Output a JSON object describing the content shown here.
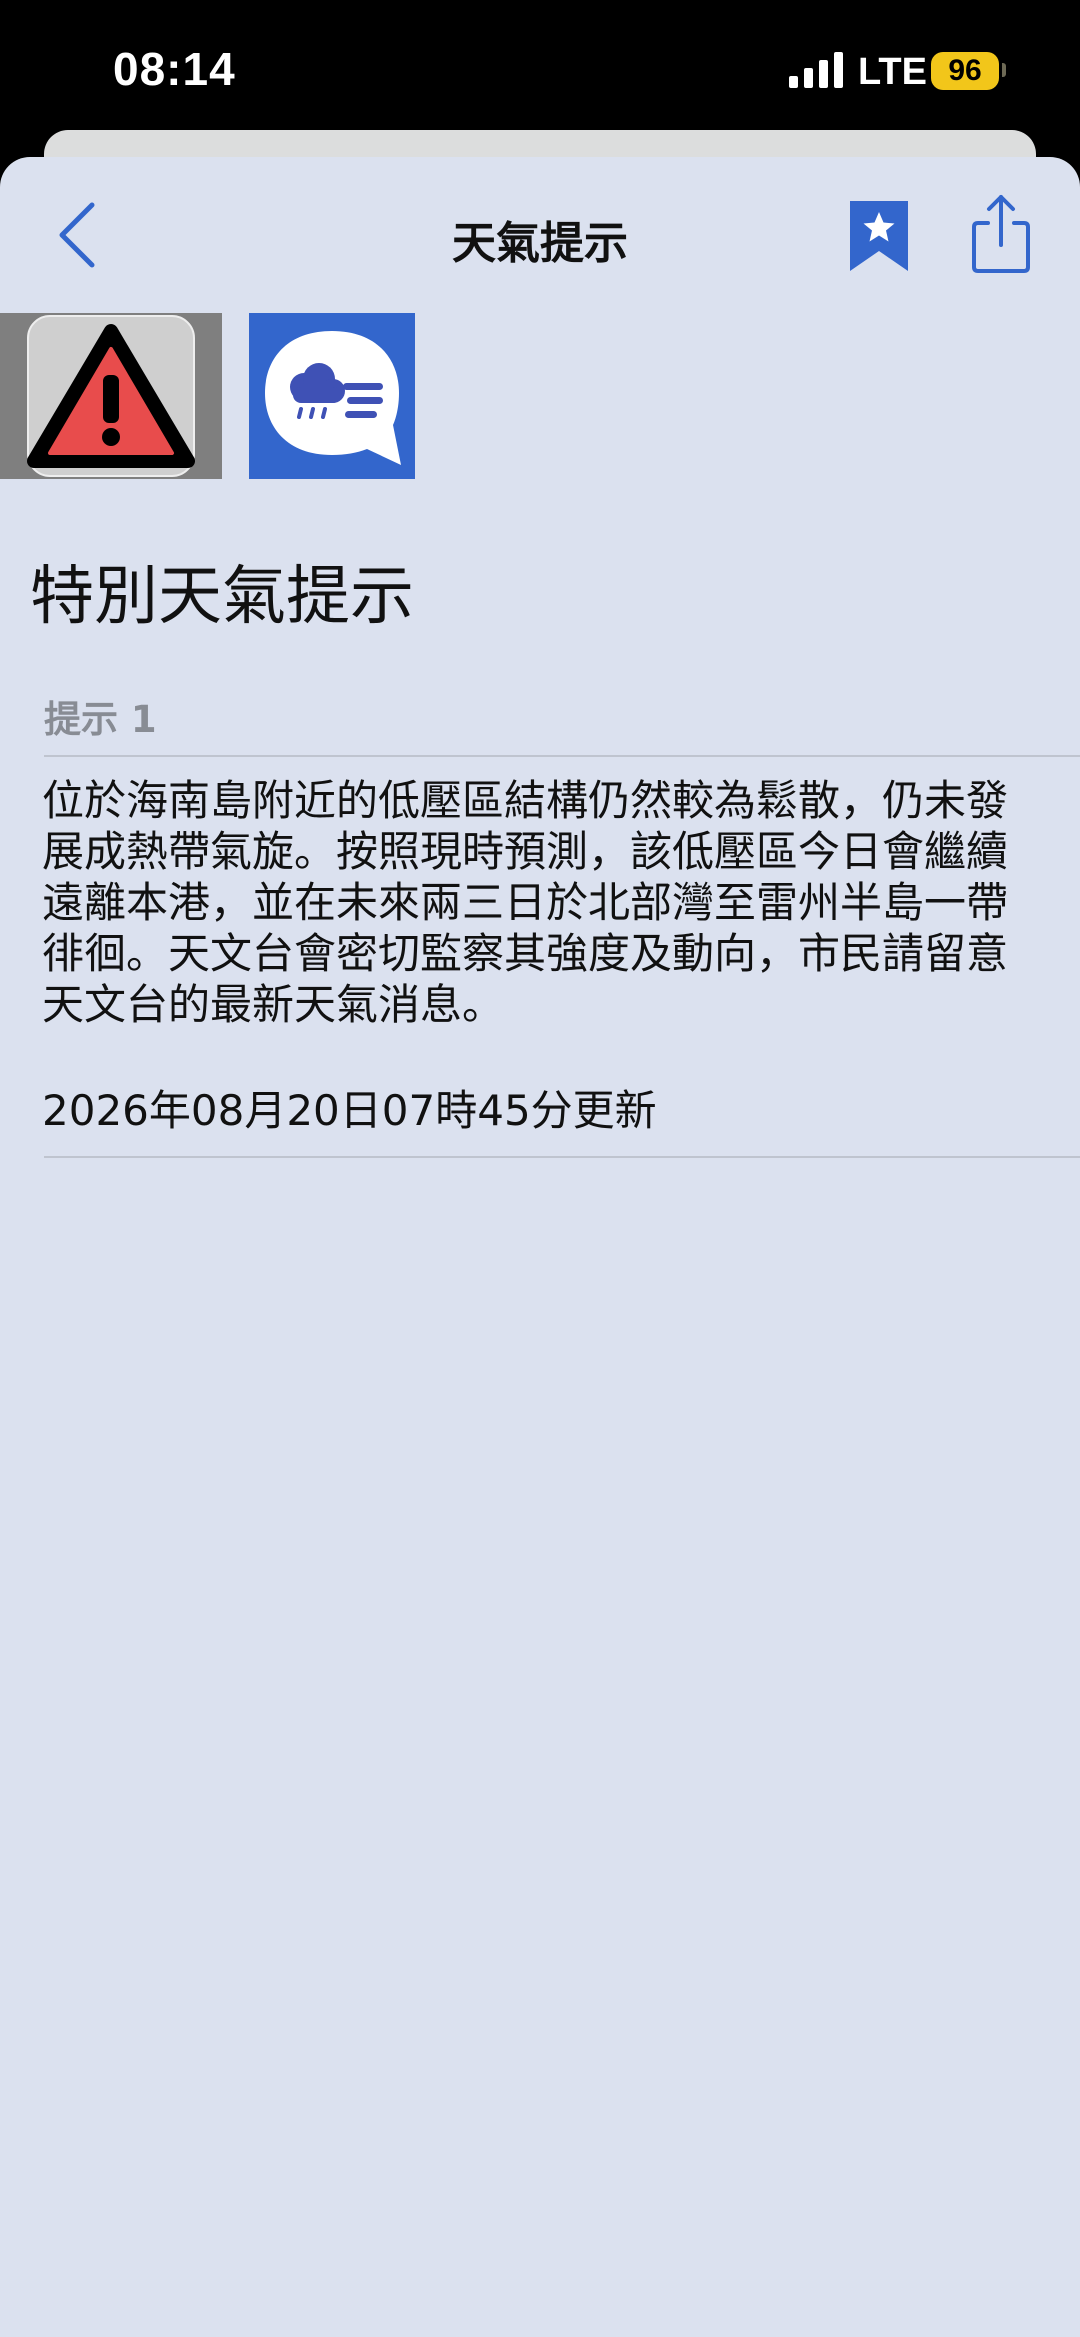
{
  "status_bar": {
    "time": "08:14",
    "network": "LTE",
    "battery": "96"
  },
  "nav": {
    "title": "天氣提示",
    "back_icon": "chevron-left-icon",
    "bookmark_icon": "bookmark-star-icon",
    "share_icon": "share-icon"
  },
  "icons": {
    "warning": "warning-triangle-icon",
    "weather": "weather-chat-icon"
  },
  "page": {
    "title": "特別天氣提示",
    "section_label": "提示 1",
    "body": "位於海南島附近的低壓區結構仍然較為鬆散，仍未發展成熱帶氣旋。按照現時預測，該低壓區今日會繼續遠離本港，並在未來兩三日於北部灣至雷州半島一帶徘徊。天文台會密切監察其強度及動向，市民請留意天文台的最新天氣消息。",
    "updated": "2026年08月20日07時45分更新"
  },
  "colors": {
    "accent": "#3366cc",
    "sheet_bg": "#dbe1ef",
    "warning_red": "#e84c4c",
    "battery": "#f2c61a"
  }
}
